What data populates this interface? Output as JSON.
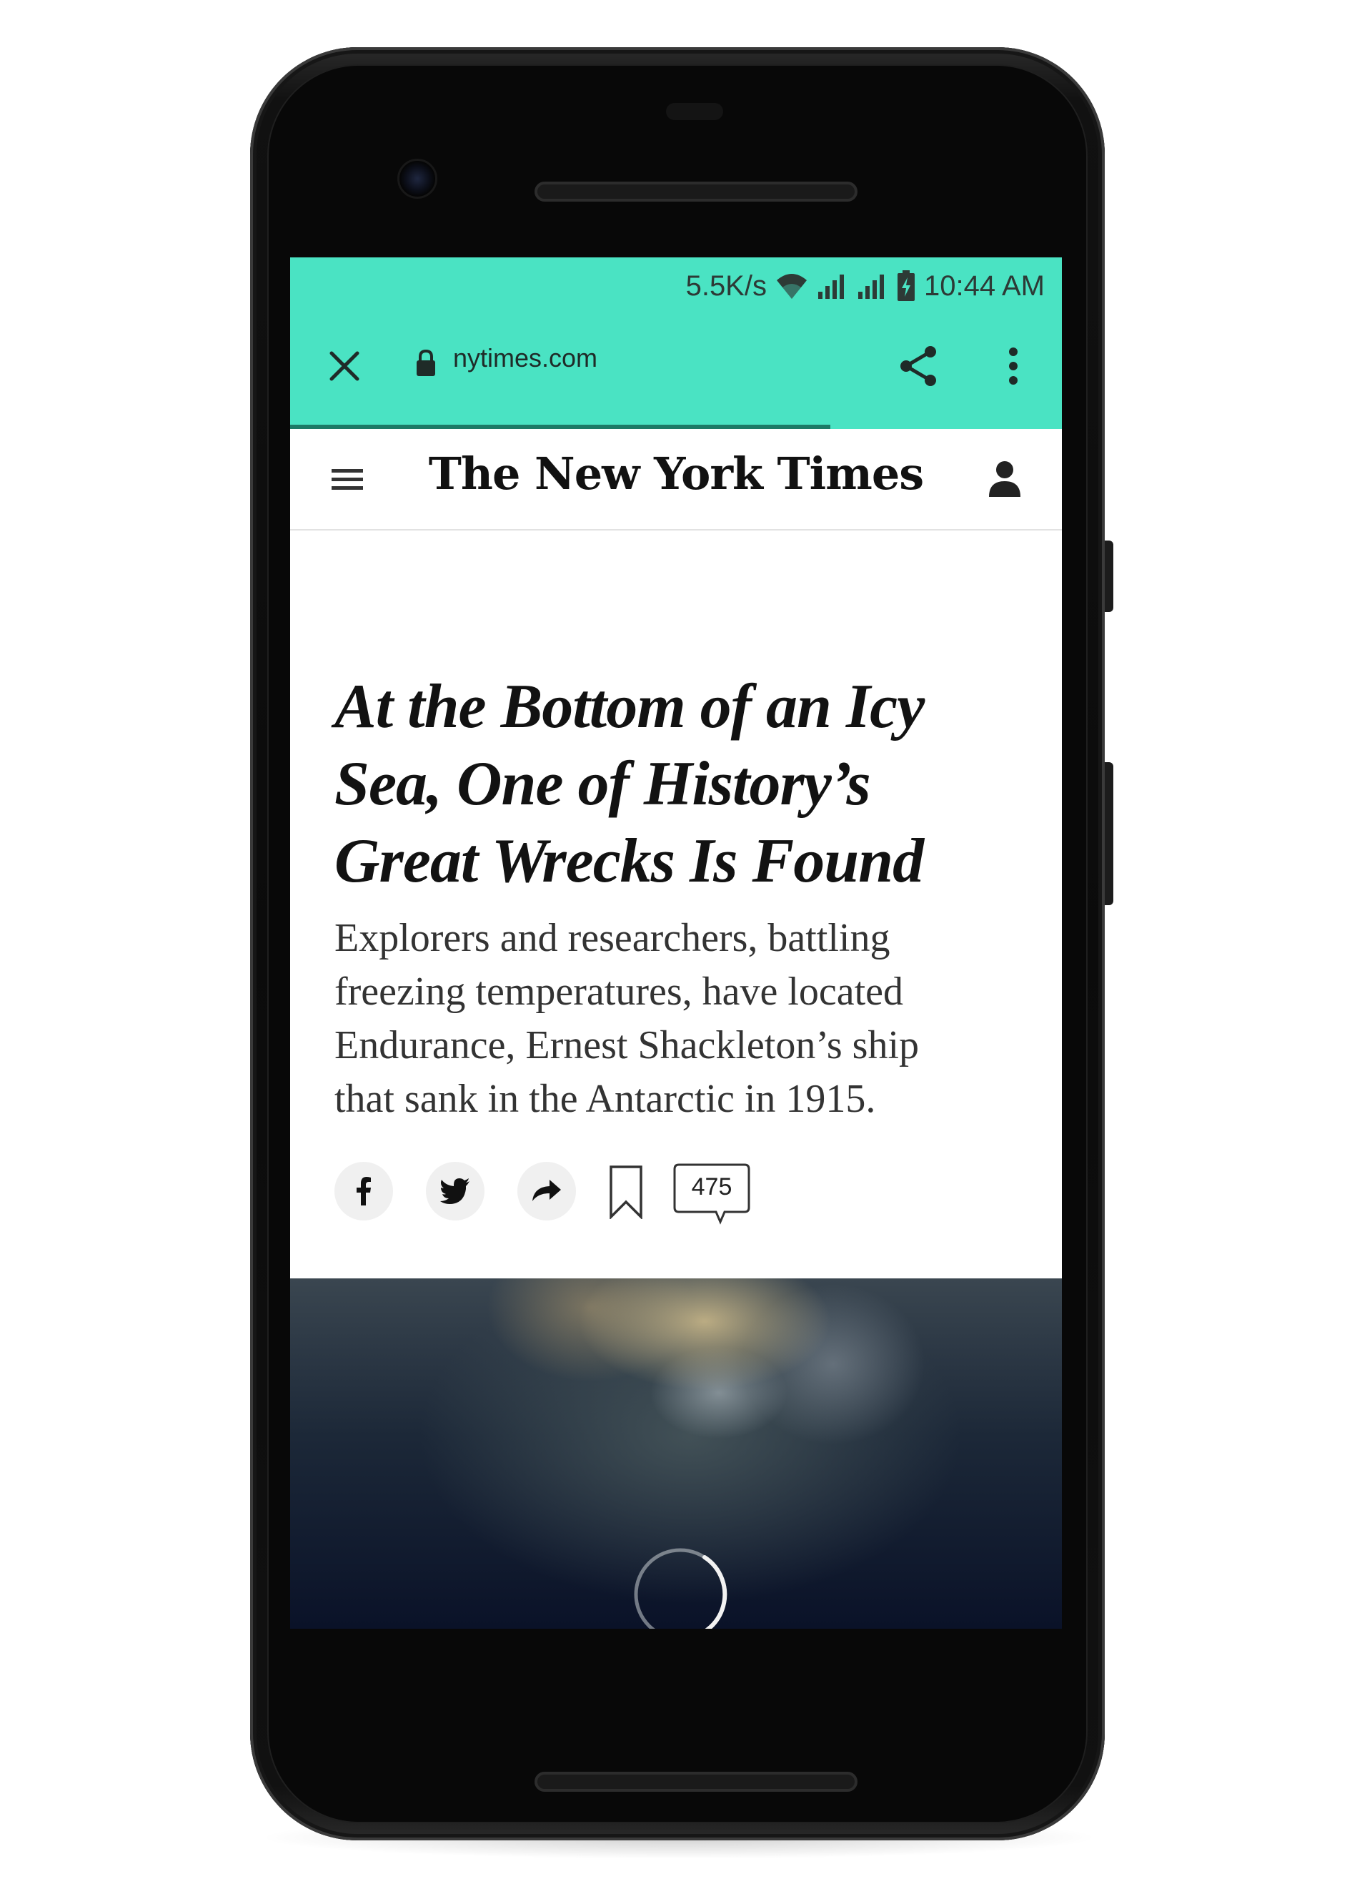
{
  "status_bar": {
    "net_speed": "5.5K/s",
    "time": "10:44 AM",
    "icons": [
      "wifi-icon",
      "signal-icon",
      "signal-icon",
      "battery-charging-icon"
    ],
    "background_color": "#4ae3c3"
  },
  "browser": {
    "close_icon": "close-icon",
    "lock_icon": "lock-icon",
    "url": "nytimes.com",
    "share_icon": "share-icon",
    "menu_icon": "more-vert-icon",
    "load_progress": 0.7
  },
  "site_header": {
    "menu_icon": "hamburger-icon",
    "logo_text": "The New York Times",
    "account_icon": "person-icon"
  },
  "article": {
    "headline": "At the Bottom of an Icy Sea, One of History’s Great Wrecks Is Found",
    "summary": "Explorers and researchers, battling freezing temperatures, have located Endurance, Ernest Shackleton’s ship that sank in the Antarctic in 1915.",
    "share_icons": [
      "facebook-icon",
      "twitter-icon",
      "share-arrow-icon",
      "bookmark-icon"
    ],
    "comment_count": "475"
  },
  "hero_image": {
    "loading": true
  }
}
